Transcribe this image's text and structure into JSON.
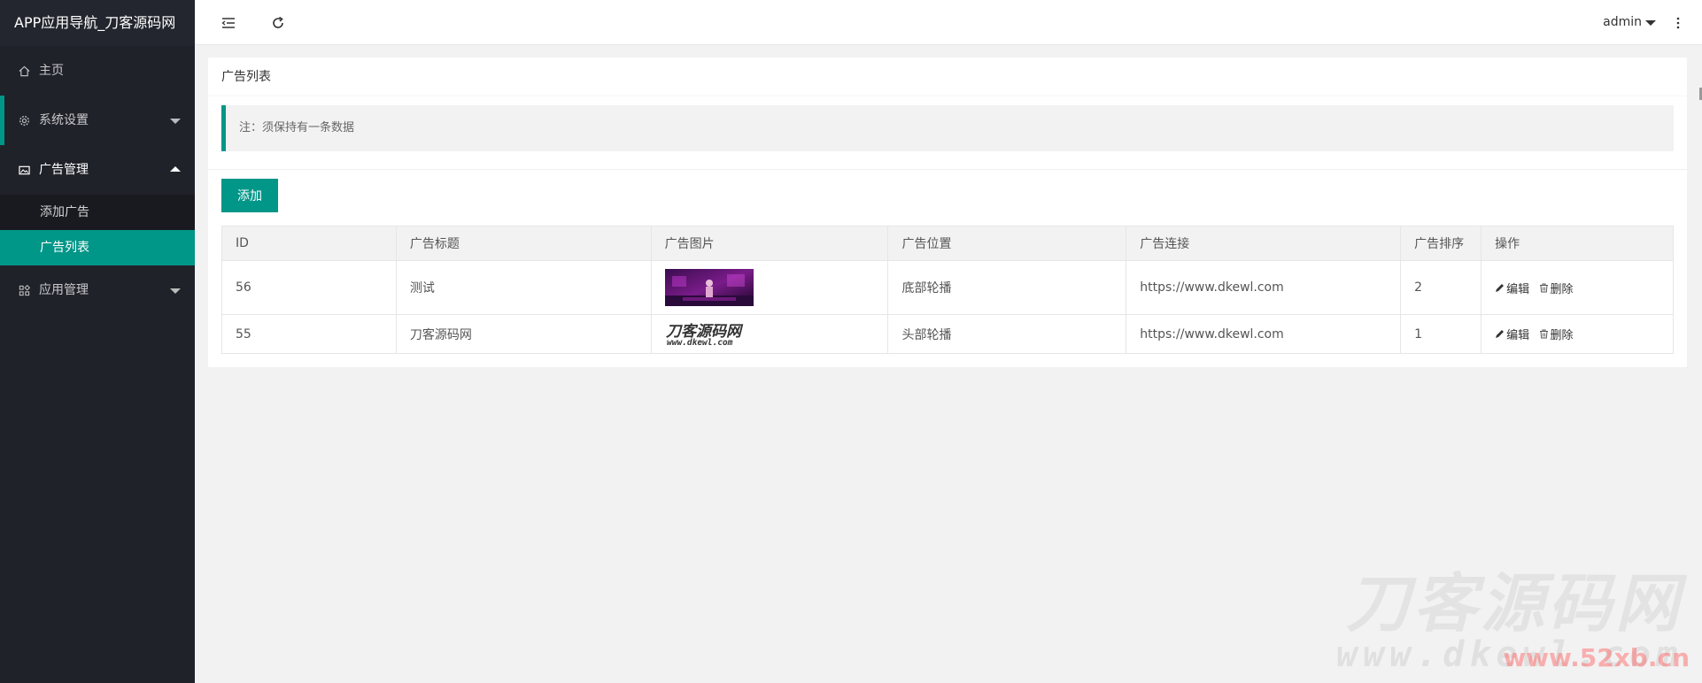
{
  "app": {
    "title": "APP应用导航_刀客源码网"
  },
  "sidebar": {
    "items": [
      {
        "label": "主页",
        "icon": "home-icon"
      },
      {
        "label": "系统设置",
        "icon": "gear-icon"
      },
      {
        "label": "广告管理",
        "icon": "image-icon",
        "children": [
          {
            "label": "添加广告"
          },
          {
            "label": "广告列表"
          }
        ]
      },
      {
        "label": "应用管理",
        "icon": "apps-icon"
      }
    ]
  },
  "header": {
    "user": "admin"
  },
  "card": {
    "title": "广告列表",
    "note": "注：须保持有一条数据",
    "add_label": "添加"
  },
  "table": {
    "columns": [
      "ID",
      "广告标题",
      "广告图片",
      "广告位置",
      "广告连接",
      "广告排序",
      "操作"
    ],
    "rows": [
      {
        "id": "56",
        "title": "测试",
        "position": "底部轮播",
        "link": "https://www.dkewl.com",
        "sort": "2"
      },
      {
        "id": "55",
        "title": "刀客源码网",
        "position": "头部轮播",
        "link": "https://www.dkewl.com",
        "sort": "1"
      }
    ],
    "edit_label": "编辑",
    "delete_label": "删除",
    "logo_text": "刀客源码网",
    "logo_url": "www.dkewl.com"
  },
  "watermark": {
    "line1": "刀客源码网",
    "line2": "www.dkewl.com",
    "line3": "www.52xb.cn"
  },
  "colors": {
    "accent": "#009688",
    "sidebar": "#20222a"
  }
}
